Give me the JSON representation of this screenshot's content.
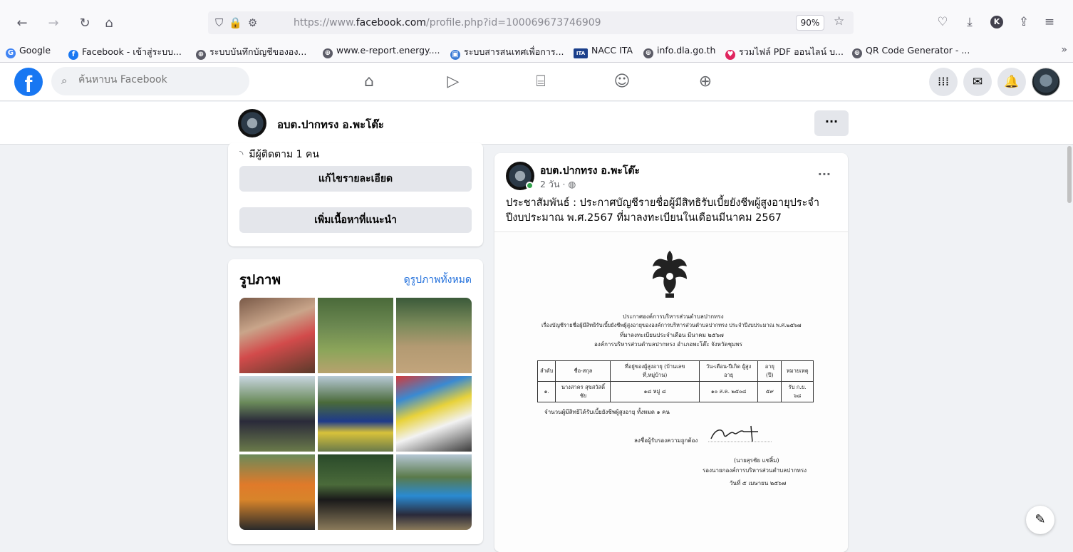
{
  "browser": {
    "url_prefix": "https://www.",
    "url_domain": "facebook.com",
    "url_path": "/profile.php?id=100069673746909",
    "zoom": "90%",
    "profile_initial": "K",
    "bookmarks": [
      {
        "label": "Google",
        "color": "#4285f4",
        "glyph": "G"
      },
      {
        "label": "Facebook - เข้าสู่ระบบ...",
        "color": "#1877f2",
        "glyph": "f"
      },
      {
        "label": "ระบบบันทึกบัญชีขององ...",
        "color": "#5b5b66",
        "glyph": "⊕"
      },
      {
        "label": "www.e-report.energy....",
        "color": "#5b5b66",
        "glyph": "⊕"
      },
      {
        "label": "ระบบสารสนเทศเพื่อการ...",
        "color": "#3a7bd5",
        "glyph": "▣"
      },
      {
        "label": "NACC ITA",
        "color": "#1b3f8b",
        "glyph": "ITA"
      },
      {
        "label": "info.dla.go.th",
        "color": "#5b5b66",
        "glyph": "⊕"
      },
      {
        "label": "รวมไฟล์ PDF ออนไลน์ บ...",
        "color": "#e0245e",
        "glyph": "♥"
      },
      {
        "label": "QR Code Generator - ...",
        "color": "#5b5b66",
        "glyph": "⊕"
      }
    ]
  },
  "fb": {
    "search_placeholder": "ค้นหาบน Facebook"
  },
  "page": {
    "name": "อบต.ปากทรง อ.พะโต๊ะ",
    "more": "···"
  },
  "intro": {
    "followers": "มีผู้ติดตาม 1 คน",
    "edit_details": "แก้ไขรายละเอียด",
    "add_featured": "เพิ่มเนื้อหาที่แนะนำ"
  },
  "photos": {
    "title": "รูปภาพ",
    "see_all": "ดูรูปภาพทั้งหมด"
  },
  "post": {
    "author": "อบต.ปากทรง อ.พะโต๊ะ",
    "time": "2 วัน · ",
    "text": "ประชาสัมพันธ์ : ประกาศบัญชีรายชื่อผู้มีสิทธิรับเบี้ยยังชีพผู้สูงอายุประจำปีงบประมาณ พ.ศ.2567 ที่มาลงทะเบียนในเดือนมีนาคม 2567",
    "more": "···",
    "doc": {
      "title1": "ประกาศองค์การบริหารส่วนตำบลปากทรง",
      "title2": "เรื่องบัญชีรายชื่อผู้มีสิทธิรับเบี้ยยังชีพผู้สูงอายุขององค์การบริหารส่วนตำบลปากทรง ประจำปีงบประมาณ พ.ศ.๒๕๖๗",
      "title3": "ที่มาลงทะเบียนประจำเดือน มีนาคม ๒๕๖๗",
      "title4": "องค์การบริหารส่วนตำบลปากทรง อำเภอพะโต๊ะ จังหวัดชุมพร",
      "headers": [
        "ลำดับ",
        "ชื่อ-สกุล",
        "ที่อยู่ของผู้สูงอายุ (บ้านเลขที่,หมู่บ้าน)",
        "วัน-เดือน-ปีเกิด ผู้สูงอายุ",
        "อายุ (ปี)",
        "หมายเหตุ"
      ],
      "row": [
        "๑.",
        "นางสาคร สุขสวัสดิ์ชัย",
        "๑๘ หมู่ ๘",
        "๑๐ ส.ค. ๒๕๐๘",
        "๕๙",
        "รับ ก.ย. ๖๘"
      ],
      "total": "จำนวนผู้มีสิทธิได้รับเบี้ยยังชีพผู้สูงอายุ ทั้งหมด ๑ คน",
      "certify": "ลงชื่อผู้รับรองความถูกต้อง",
      "signer": "(นายสุรชัย แซ่ลิ้ม)",
      "position": "รองนายกองค์การบริหารส่วนตำบลปากทรง",
      "date": "วันที่ ๕ เมษายน ๒๕๖๗"
    }
  }
}
